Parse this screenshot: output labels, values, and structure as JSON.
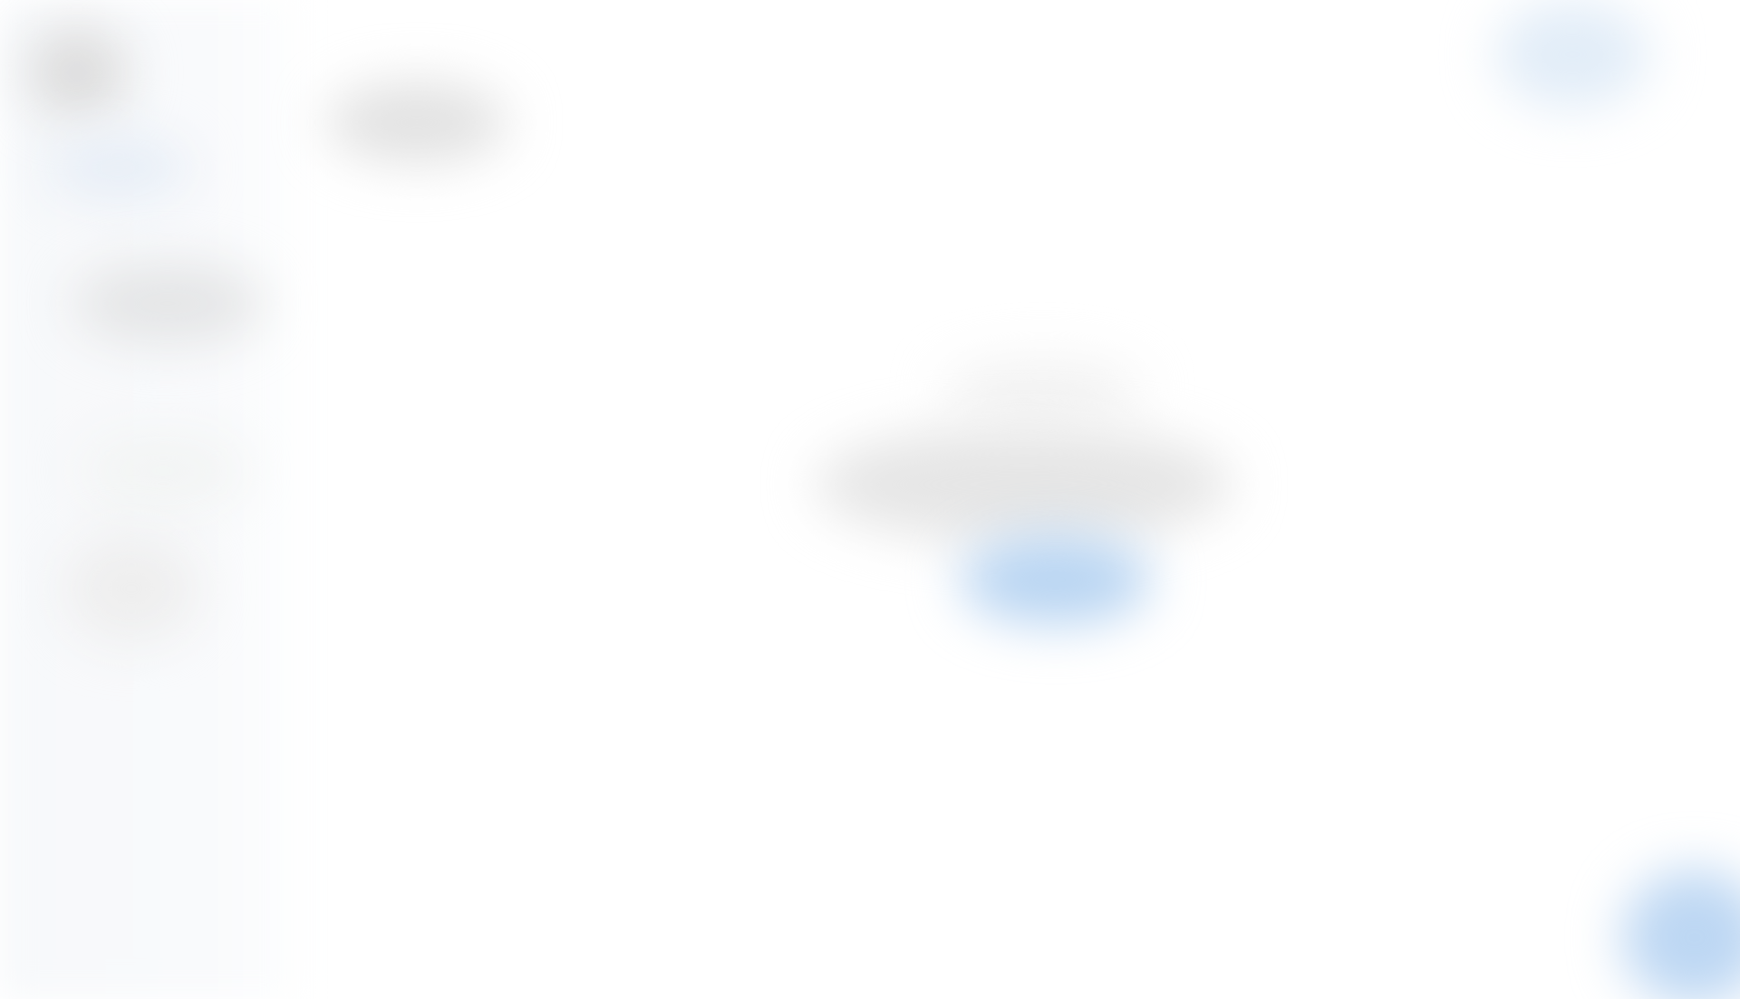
{
  "colors": {
    "background": "#ffffff",
    "sidebar": "#f8f9fb",
    "accent": "#b9d5f2"
  },
  "icons": {
    "avatar": "avatar-icon",
    "fab": "add-icon",
    "top_right": "account-icon"
  }
}
